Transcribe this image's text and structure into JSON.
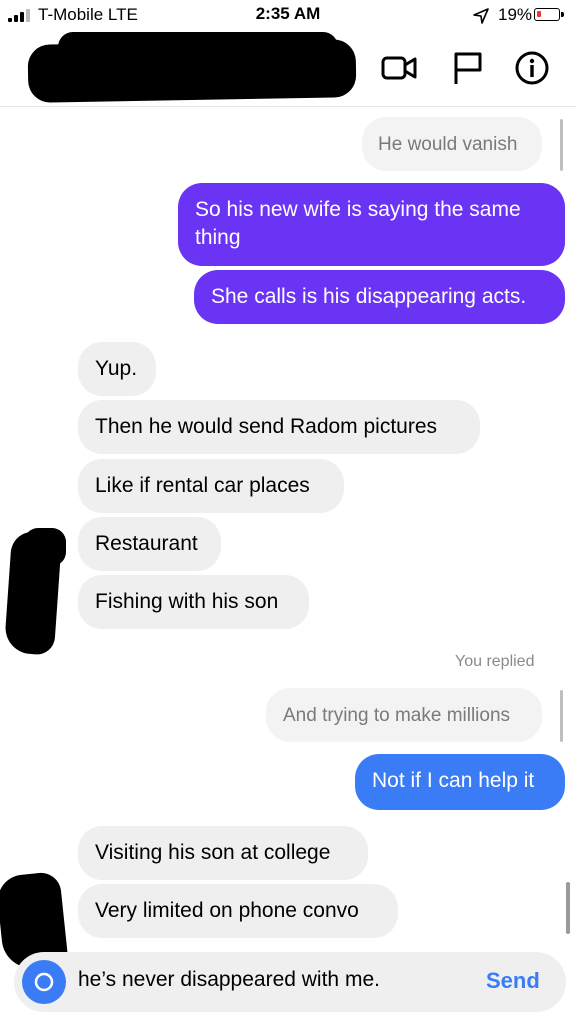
{
  "status_bar": {
    "carrier": "T-Mobile  LTE",
    "time": "2:35 AM",
    "battery": "19%",
    "battery_level": 0.19
  },
  "header": {
    "contact_name": "",
    "icons": [
      "video-call-icon",
      "flag-icon",
      "info-icon"
    ]
  },
  "messages": {
    "m1": "He would vanish",
    "m2_line1": "So his new wife is saying the same",
    "m2_line2": "thing",
    "m3": "She calls is his disappearing acts.",
    "m4": "Yup.",
    "m5": "Then he would send Radom pictures",
    "m6": "Like if rental car places",
    "m7": "Restaurant",
    "m8": "Fishing with his son",
    "replied_label": "You replied",
    "m9": "And trying to make millions",
    "m10": "Not if I can help it",
    "m11": "Visiting his son at college",
    "m12": "Very limited on phone convo"
  },
  "composer": {
    "value": "he’s never disappeared with me.",
    "send_label": "Send"
  },
  "colors": {
    "purple_bubble": "#6b34f5",
    "blue_bubble": "#3a7cf6",
    "incoming_bubble": "#efefef"
  }
}
